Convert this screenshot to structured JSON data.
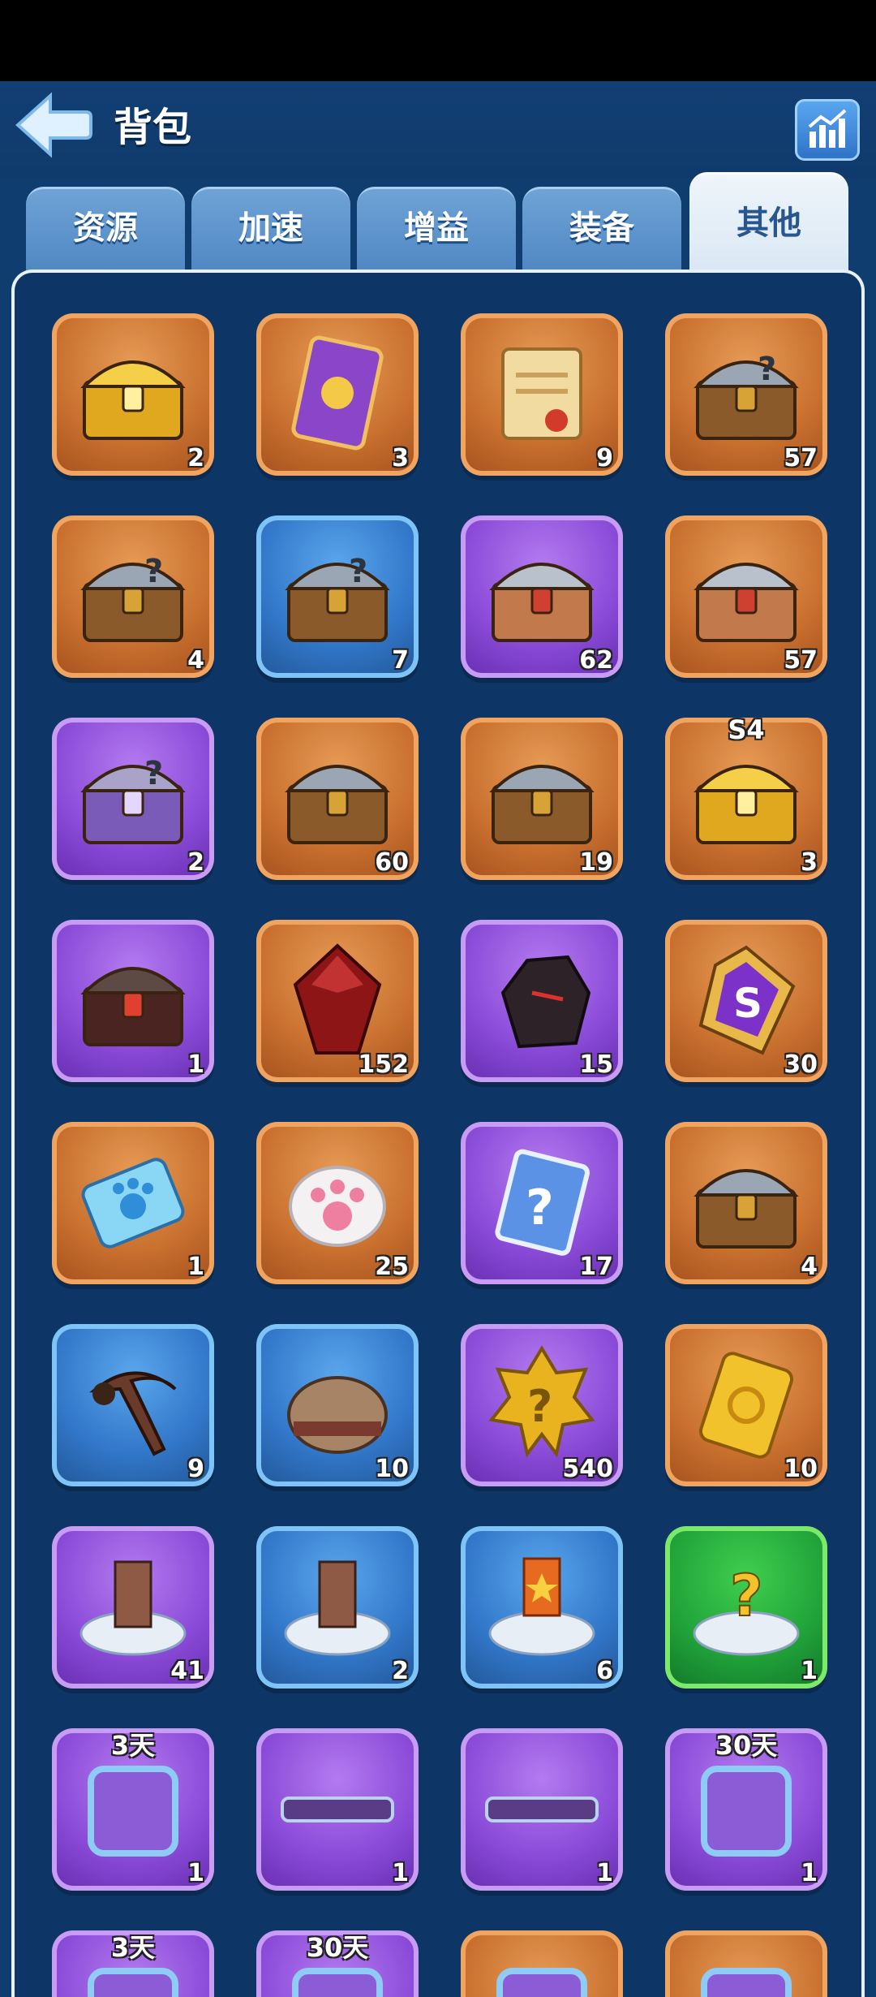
{
  "header": {
    "title": "背包"
  },
  "tabs": [
    {
      "label": "资源",
      "active": false
    },
    {
      "label": "加速",
      "active": false
    },
    {
      "label": "增益",
      "active": false
    },
    {
      "label": "装备",
      "active": false
    },
    {
      "label": "其他",
      "active": true
    }
  ],
  "colors": {
    "orange": "#f0a460",
    "blue": "#7ec4f6",
    "purple": "#c89cf5",
    "green": "#7bea6a",
    "background": "#0f3d70"
  },
  "items": [
    {
      "icon": "golden-treasure-chest-icon",
      "rarity": "orange",
      "count": "2"
    },
    {
      "icon": "purple-card-icon",
      "rarity": "orange",
      "count": "3"
    },
    {
      "icon": "scroll-icon",
      "rarity": "orange",
      "count": "9"
    },
    {
      "icon": "mystery-chest-icon",
      "rarity": "orange",
      "count": "57"
    },
    {
      "icon": "mystery-chest-cards-icon",
      "rarity": "orange",
      "count": "4"
    },
    {
      "icon": "wooden-mystery-chest-icon",
      "rarity": "blue",
      "count": "7"
    },
    {
      "icon": "crest-chest-icon",
      "rarity": "purple",
      "count": "62"
    },
    {
      "icon": "crest-chest-icon",
      "rarity": "orange",
      "count": "57"
    },
    {
      "icon": "purple-mystery-chest-icon",
      "rarity": "purple",
      "count": "2"
    },
    {
      "icon": "bronze-chest-icon",
      "rarity": "orange",
      "count": "60"
    },
    {
      "icon": "helmet-chest-icon",
      "rarity": "orange",
      "count": "19"
    },
    {
      "icon": "season-treasure-icon",
      "rarity": "orange",
      "count": "3",
      "tag": "S4"
    },
    {
      "icon": "dark-hero-chest-icon",
      "rarity": "purple",
      "count": "1"
    },
    {
      "icon": "red-gem-icon",
      "rarity": "orange",
      "count": "152"
    },
    {
      "icon": "dark-ore-icon",
      "rarity": "purple",
      "count": "15"
    },
    {
      "icon": "purple-rune-icon",
      "rarity": "orange",
      "count": "30"
    },
    {
      "icon": "paw-ticket-icon",
      "rarity": "orange",
      "count": "1"
    },
    {
      "icon": "paw-badge-icon",
      "rarity": "orange",
      "count": "25"
    },
    {
      "icon": "mystery-card-icon",
      "rarity": "purple",
      "count": "17"
    },
    {
      "icon": "tool-crate-icon",
      "rarity": "orange",
      "count": "4"
    },
    {
      "icon": "scythe-icon",
      "rarity": "blue",
      "count": "9"
    },
    {
      "icon": "sack-icon",
      "rarity": "blue",
      "count": "10"
    },
    {
      "icon": "mystery-medal-icon",
      "rarity": "purple",
      "count": "540"
    },
    {
      "icon": "golden-ticket-icon",
      "rarity": "orange",
      "count": "10"
    },
    {
      "icon": "building-skin-icon",
      "rarity": "purple",
      "count": "41"
    },
    {
      "icon": "building-skin-icon",
      "rarity": "blue",
      "count": "2"
    },
    {
      "icon": "banner-platform-icon",
      "rarity": "blue",
      "count": "6"
    },
    {
      "icon": "mystery-platform-icon",
      "rarity": "green",
      "count": "1"
    },
    {
      "icon": "avatar-frame-icon",
      "rarity": "purple",
      "count": "1",
      "tag": "3天"
    },
    {
      "icon": "name-plate-icon",
      "rarity": "purple",
      "count": "1"
    },
    {
      "icon": "name-plate-icon",
      "rarity": "purple",
      "count": "1"
    },
    {
      "icon": "avatar-frame-icon",
      "rarity": "purple",
      "count": "1",
      "tag": "30天"
    },
    {
      "icon": "avatar-frame-icon",
      "rarity": "purple",
      "count": "",
      "tag": "3天"
    },
    {
      "icon": "avatar-frame-icon",
      "rarity": "purple",
      "count": "",
      "tag": "30天"
    },
    {
      "icon": "avatar-frame-icon",
      "rarity": "orange",
      "count": ""
    },
    {
      "icon": "avatar-frame-icon",
      "rarity": "orange",
      "count": ""
    }
  ]
}
